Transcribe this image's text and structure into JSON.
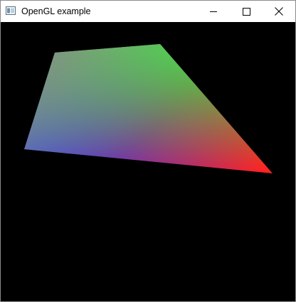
{
  "window": {
    "title": "OpenGL example",
    "icon": "app-window-icon"
  },
  "caption_buttons": {
    "minimize_icon": "minimize-icon",
    "maximize_icon": "maximize-icon",
    "close_icon": "close-icon"
  },
  "viewport": {
    "background": "#000000",
    "vertex_colors": {
      "top_left": "#7f7f7f",
      "top_right": "#22ee22",
      "bottom_left": "#2222ff",
      "bottom_right": "#ff2222"
    }
  }
}
